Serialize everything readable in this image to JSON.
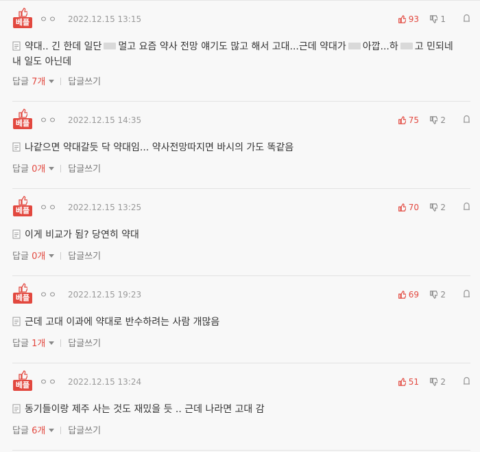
{
  "comments": [
    {
      "badge": "베플",
      "nickname": "ㅇㅇ",
      "date": "2022.12.15 13:15",
      "up": "93",
      "down": "1",
      "text_parts": [
        "약대.. 긴 한데 일단",
        "멀고 요즘 약사 전망 얘기도 많고 해서 고대...근데 약대가",
        "아깝...하",
        "고 민되네 내 일도 아닌데"
      ],
      "reply_label": "답글",
      "reply_count": "7개",
      "write_label": "답글쓰기"
    },
    {
      "badge": "베플",
      "nickname": "ㅇㅇ",
      "date": "2022.12.15 14:35",
      "up": "75",
      "down": "2",
      "text": "나같으면 약대갈듯 닥 약대임... 약사전망따지면 바시의 가도 똑같음",
      "reply_label": "답글",
      "reply_count": "0개",
      "write_label": "답글쓰기"
    },
    {
      "badge": "베플",
      "nickname": "ㅇㅇ",
      "date": "2022.12.15 13:25",
      "up": "70",
      "down": "2",
      "text": "이게 비교가 됨? 당연히 약대",
      "reply_label": "답글",
      "reply_count": "0개",
      "write_label": "답글쓰기"
    },
    {
      "badge": "베플",
      "nickname": "ㅇㅇ",
      "date": "2022.12.15 19:23",
      "up": "69",
      "down": "2",
      "text": "근데 고대 이과에 약대로 반수하려는 사람 개많음",
      "reply_label": "답글",
      "reply_count": "1개",
      "write_label": "답글쓰기"
    },
    {
      "badge": "베플",
      "nickname": "ㅇㅇ",
      "date": "2022.12.15 13:24",
      "up": "51",
      "down": "2",
      "text": "동기들이랑 제주 사는 것도 재밌을 듯 .. 근데 나라면 고대 감",
      "reply_label": "답글",
      "reply_count": "6개",
      "write_label": "답글쓰기"
    }
  ],
  "colors": {
    "accent": "#e2483f",
    "muted": "#888888",
    "background": "#f8f8f8"
  },
  "icons": {
    "up": "thumbs-up-icon",
    "down": "thumbs-down-icon",
    "report": "report-icon",
    "doc": "document-icon",
    "best": "best-thumb-icon"
  }
}
